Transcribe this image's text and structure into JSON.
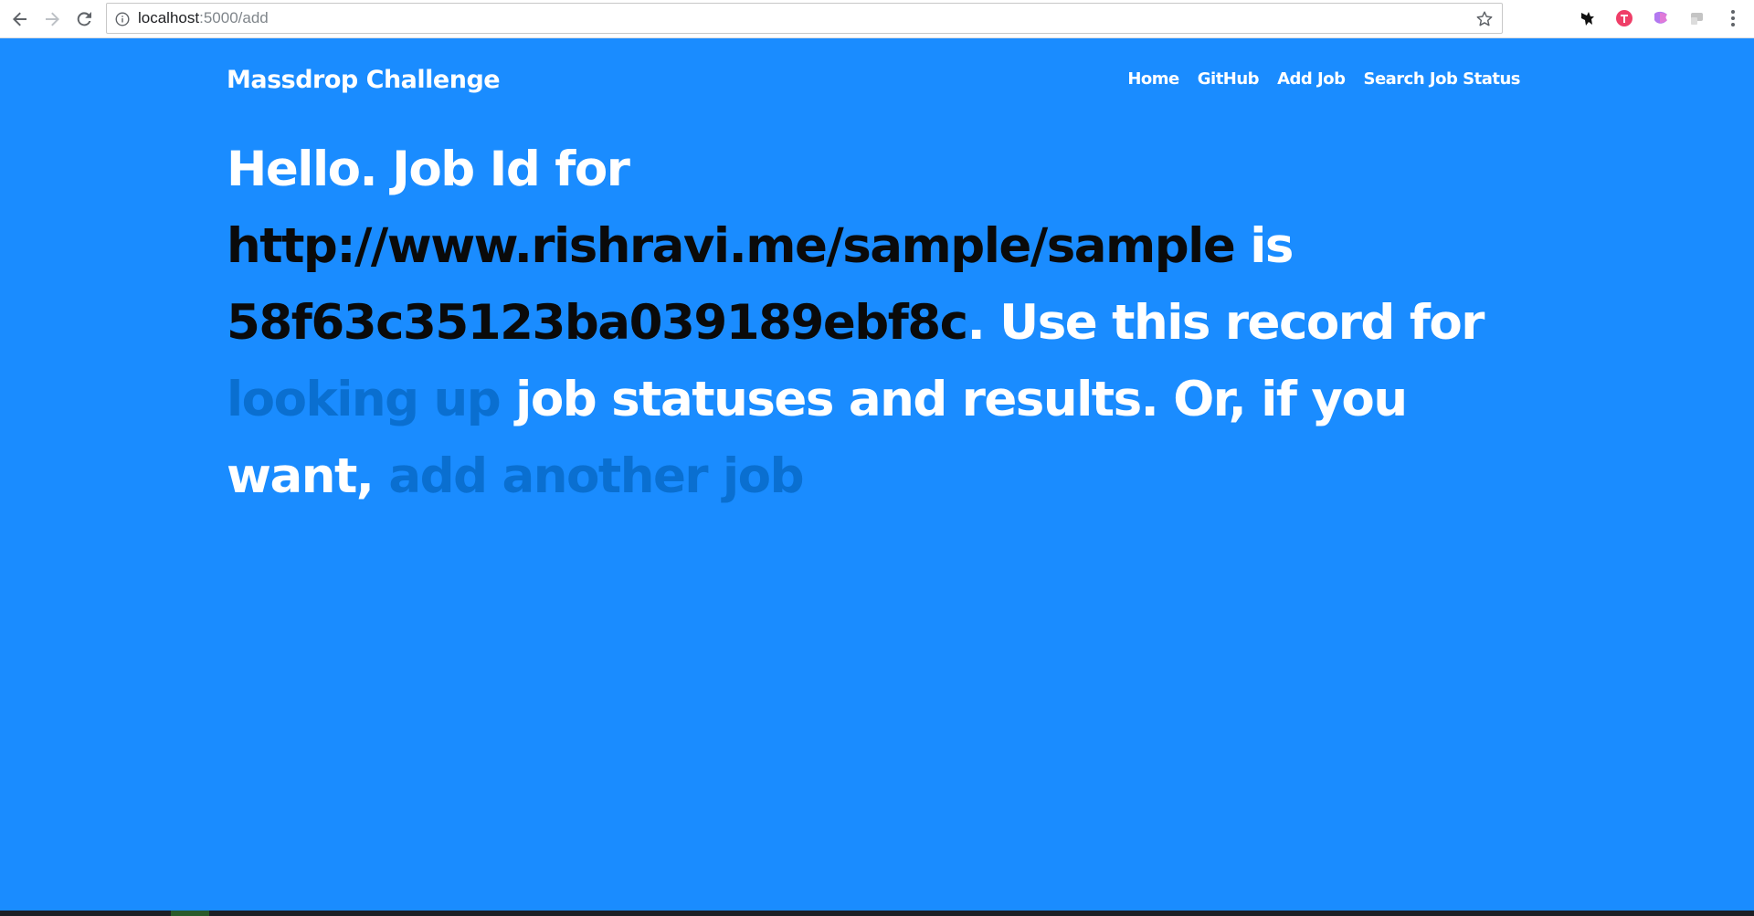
{
  "browser": {
    "url_host": "localhost",
    "url_path": ":5000/add",
    "extensions": [
      "bird-extension-icon",
      "t-extension-icon",
      "colorful-extension-icon",
      "gray-extension-icon"
    ]
  },
  "header": {
    "brand": "Massdrop Challenge",
    "nav": {
      "home": "Home",
      "github": "GitHub",
      "add_job": "Add Job",
      "search_job_status": "Search Job Status"
    }
  },
  "message": {
    "greeting": "Hello. Job Id for",
    "url": "http://www.rishravi.me/sample/sample",
    "is": "is",
    "job_id": "58f63c35123ba039189ebf8c",
    "period": ".",
    "use_text": "Use this record for",
    "lookup_link": "looking up",
    "statuses_text": "job statuses and results. Or, if you want,",
    "add_link": "add another job"
  },
  "colors": {
    "background": "#1a8cff",
    "text": "#ffffff",
    "emphasis": "#0a0a0a",
    "link": "#0a6fd0"
  }
}
